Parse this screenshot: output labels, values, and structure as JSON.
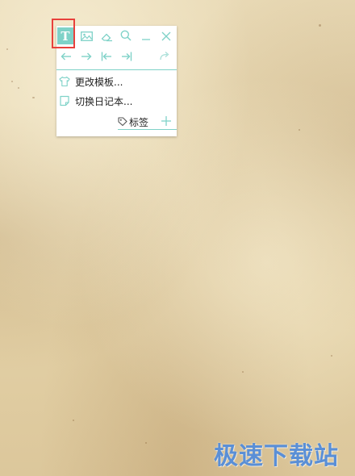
{
  "toolbar": {
    "text_button_label": "T",
    "icons": {
      "text": "text-format-icon",
      "image": "image-icon",
      "eraser": "eraser-icon",
      "search": "search-icon",
      "minimize": "minimize-icon",
      "close": "close-icon",
      "undo": "arrow-left-icon",
      "redo": "arrow-right-icon",
      "first": "jump-to-start-icon",
      "last": "jump-to-end-icon",
      "share": "share-icon"
    }
  },
  "menu": {
    "items": [
      {
        "label": "更改模板...",
        "icon": "shirt-icon"
      },
      {
        "label": "切换日记本...",
        "icon": "notebook-icon"
      }
    ]
  },
  "tags": {
    "label": "标签",
    "icon": "tag-icon",
    "add_icon": "plus-icon"
  },
  "watermark": {
    "text": "极速下载站"
  },
  "colors": {
    "accent": "#7fd2c8",
    "highlight": "#e8413c",
    "panel_background": "#ffffff",
    "paper": "#e6d6b0",
    "watermark": "#5a8fd6"
  }
}
